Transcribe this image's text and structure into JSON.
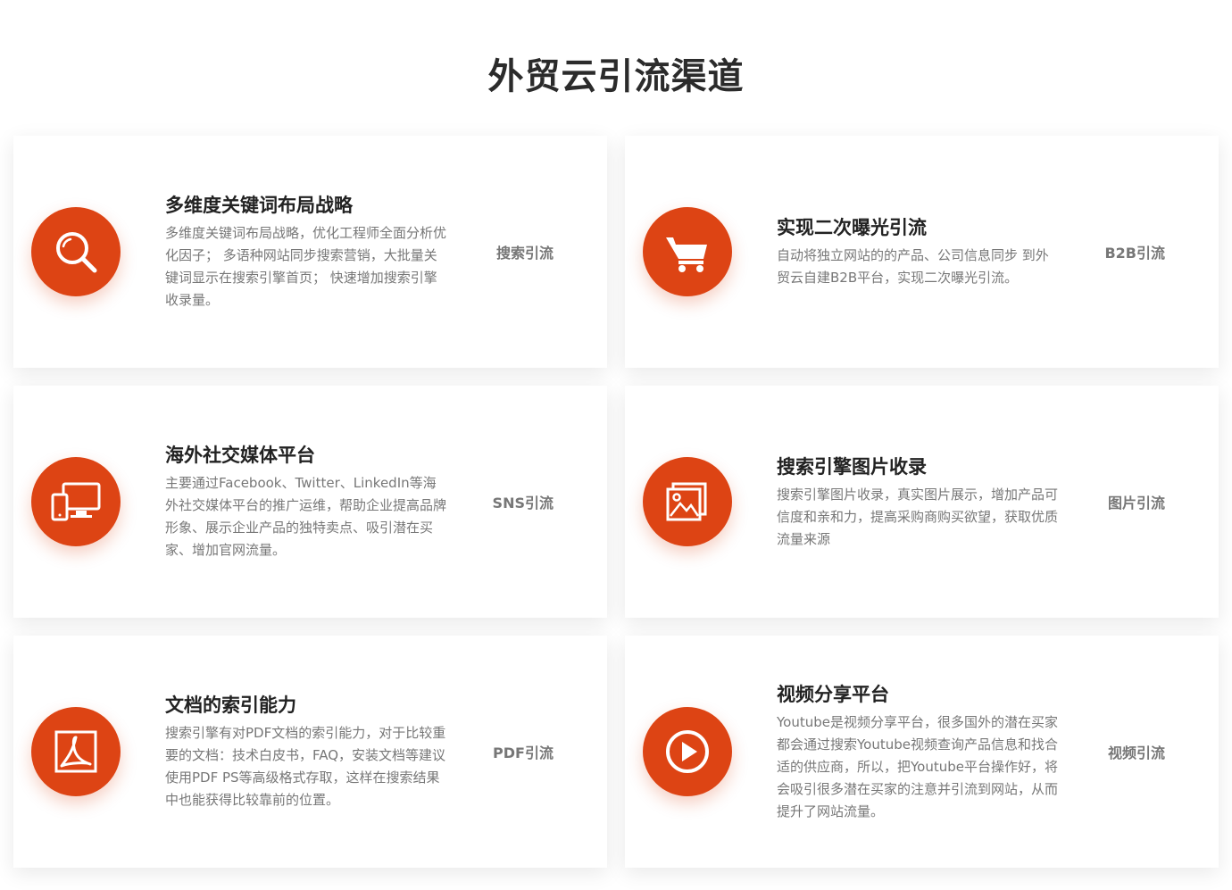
{
  "page": {
    "title": "外贸云引流渠道",
    "accent_color": "#dd4414"
  },
  "cards": [
    {
      "icon": "search-icon",
      "title": "多维度关键词布局战略",
      "desc": "多维度关键词布局战略，优化工程师全面分析优化因子； 多语种网站同步搜索营销，大批量关键词显示在搜索引擎首页； 快速增加搜索引擎收录量。",
      "tag": "搜索引流"
    },
    {
      "icon": "cart-icon",
      "title": "实现二次曝光引流",
      "desc": "自动将独立网站的的产品、公司信息同步 到外贸云自建B2B平台，实现二次曝光引流。",
      "tag": "B2B引流"
    },
    {
      "icon": "devices-icon",
      "title": "海外社交媒体平台",
      "desc": "主要通过Facebook、Twitter、LinkedIn等海外社交媒体平台的推广运维，帮助企业提高品牌形象、展示企业产品的独特卖点、吸引潜在买家、增加官网流量。",
      "tag": "SNS引流"
    },
    {
      "icon": "image-icon",
      "title": "搜索引擎图片收录",
      "desc": "搜索引擎图片收录，真实图片展示，增加产品可信度和亲和力，提高采购商购买欲望，获取优质流量来源",
      "tag": "图片引流"
    },
    {
      "icon": "pdf-icon",
      "title": "文档的索引能力",
      "desc": "搜索引擎有对PDF文档的索引能力，对于比较重要的文档：技术白皮书，FAQ，安装文档等建议使用PDF PS等高级格式存取，这样在搜索结果中也能获得比较靠前的位置。",
      "tag": "PDF引流"
    },
    {
      "icon": "play-icon",
      "title": "视频分享平台",
      "desc": "Youtube是视频分享平台，很多国外的潜在买家都会通过搜索Youtube视频查询产品信息和找合适的供应商，所以，把Youtube平台操作好，将会吸引很多潜在买家的注意并引流到网站，从而提升了网站流量。",
      "tag": "视频引流"
    }
  ]
}
